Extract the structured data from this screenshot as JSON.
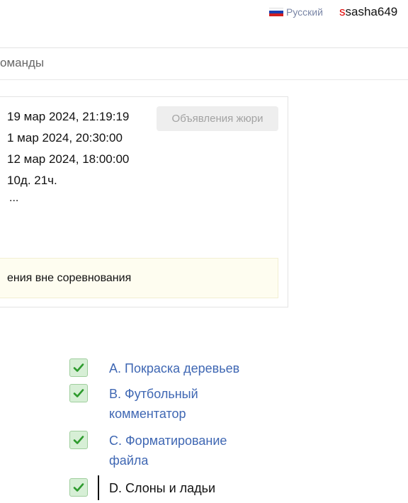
{
  "header": {
    "language": "Русский",
    "username_first": "s",
    "username_rest": "sasha649"
  },
  "nav": {
    "item": "оманды"
  },
  "contest": {
    "lines": [
      "19 мар 2024, 21:19:19",
      "1 мар 2024, 20:30:00",
      "12 мар 2024, 18:00:00",
      "10д. 21ч.",
      "..."
    ],
    "jury_button": "Объявления жюри",
    "notice": "ения вне соревнования"
  },
  "problems": [
    {
      "label": "A. Покраска деревьев",
      "status": "accepted"
    },
    {
      "label": "B. Футбольный комментатор",
      "status": "accepted"
    },
    {
      "label": "C. Форматирование файла",
      "status": "accepted"
    },
    {
      "label": "D. Слоны и ладьи",
      "status": "accepted"
    }
  ],
  "colors": {
    "link": "#3f67b3",
    "accepted_bg": "#d7efd6",
    "accepted_check": "#2e9b2e",
    "notice_bg": "#fefdf0"
  }
}
